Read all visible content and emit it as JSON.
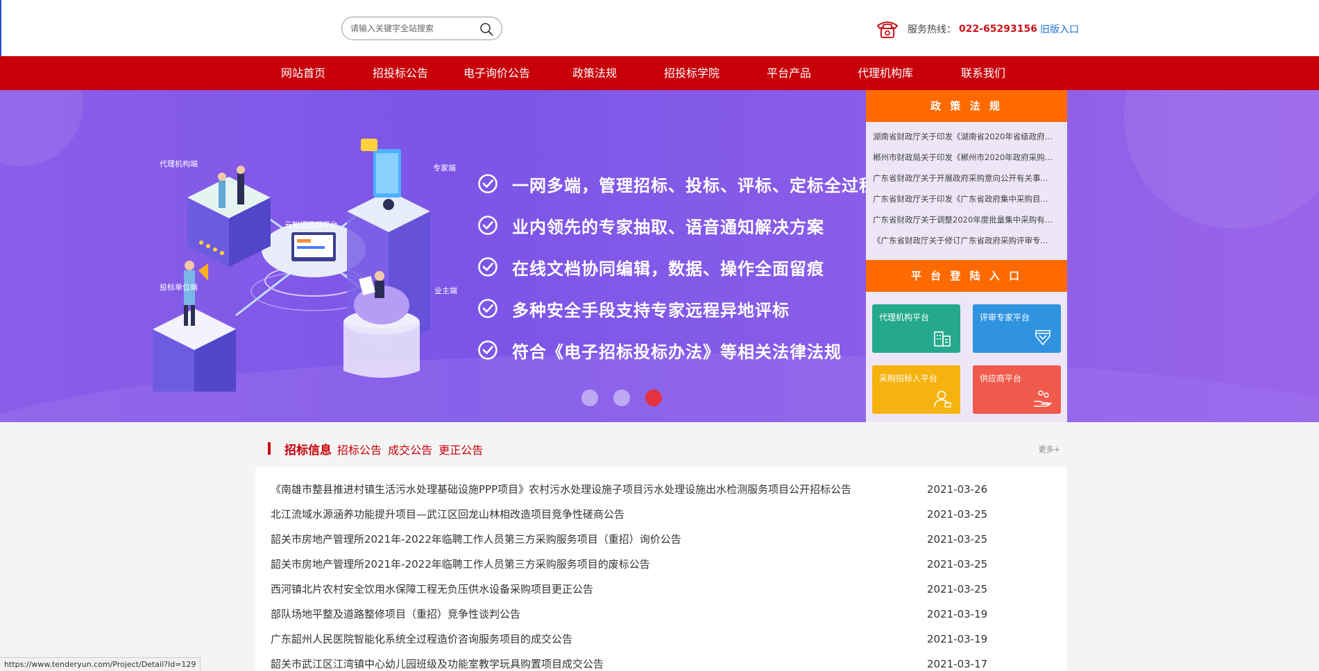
{
  "search": {
    "placeholder": "请输入关键字全站搜索"
  },
  "hotline": {
    "label": "服务热线：",
    "number": "022-65293156",
    "old_link": "旧版入口"
  },
  "nav": [
    "网站首页",
    "招投标公告",
    "电子询价公告",
    "政策法规",
    "招投标学院",
    "平台产品",
    "代理机构库",
    "联系我们"
  ],
  "banner": {
    "illustration_labels": [
      "代理机构端",
      "专家端",
      "云智招投标平台",
      "投标单位端",
      "业主端"
    ],
    "bullets": [
      "一网多端，管理招标、投标、评标、定标全过程",
      "业内领先的专家抽取、语音通知解决方案",
      "在线文档协同编辑，数据、操作全面留痕",
      "多种安全手段支持专家远程异地评标",
      "符合《电子招标投标办法》等相关法律法规"
    ],
    "slide_count": 3,
    "active_slide": 3
  },
  "policy": {
    "title": "政 策 法 规",
    "items": [
      "湖南省财政厅关于印发《湖南省2020年省级政府...",
      "郴州市财政局关于印发《郴州市2020年政府采购...",
      "广东省财政厅关于开展政府采购意向公开有关事...",
      "广东省财政厅关于印发《广东省政府集中采购目...",
      "广东省财政厅关于调整2020年度批量集中采购有...",
      "《广东省财政厅关于修订广东省政府采购评审专..."
    ]
  },
  "login": {
    "title": "平 台 登 陆 入 口",
    "tiles": [
      {
        "label": "代理机构平台",
        "color": "#25a98c",
        "icon": "building-icon"
      },
      {
        "label": "评审专家平台",
        "color": "#2f93e0",
        "icon": "badge-icon"
      },
      {
        "label": "采购招标人平台",
        "color": "#f6b20e",
        "icon": "user-icon"
      },
      {
        "label": "供应商平台",
        "color": "#f05a4c",
        "icon": "hand-coins-icon"
      }
    ]
  },
  "notices": {
    "title": "招标信息",
    "tabs": [
      "招标公告",
      "成交公告",
      "更正公告"
    ],
    "more": "更多+",
    "rows": [
      {
        "title": "《南雄市整县推进村镇生活污水处理基础设施PPP项目》农村污水处理设施子项目污水处理设施出水检测服务项目公开招标公告",
        "date": "2021-03-26"
      },
      {
        "title": "北江流域水源涵养功能提升项目—武江区回龙山林相改造项目竞争性磋商公告",
        "date": "2021-03-25"
      },
      {
        "title": "韶关市房地产管理所2021年-2022年临聘工作人员第三方采购服务项目（重招）询价公告",
        "date": "2021-03-25"
      },
      {
        "title": "韶关市房地产管理所2021年-2022年临聘工作人员第三方采购服务项目的废标公告",
        "date": "2021-03-25"
      },
      {
        "title": "西河镇北片农村安全饮用水保障工程无负压供水设备采购项目更正公告",
        "date": "2021-03-25"
      },
      {
        "title": "部队场地平整及道路整修项目（重招）竞争性谈判公告",
        "date": "2021-03-19"
      },
      {
        "title": "广东韶州人民医院智能化系统全过程造价咨询服务项目的成交公告",
        "date": "2021-03-19"
      },
      {
        "title": "韶关市武江区江湾镇中心幼儿园班级及功能室教学玩具购置项目成交公告",
        "date": "2021-03-17"
      }
    ]
  },
  "status_url": "https://www.tenderyun.com/Project/Detail?Id=129",
  "colors": {
    "nav_red": "#c8000a",
    "panel_orange": "#ff6a00",
    "banner_purple": "#7c55e7"
  }
}
